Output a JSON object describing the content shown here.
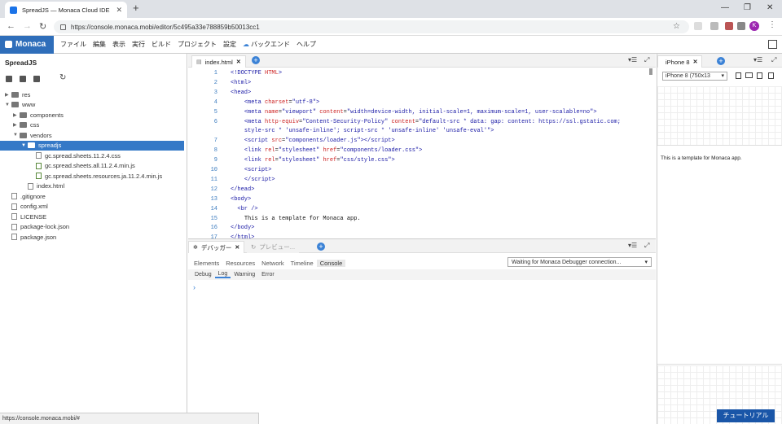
{
  "browser": {
    "tab_title": "SpreadJS — Monaca Cloud IDE",
    "url": "https://console.monaca.mobi/editor/5c495a33e788859b50013cc1",
    "avatar_letter": "K",
    "status_url": "https://console.monaca.mobi/#"
  },
  "menu": {
    "logo": "Monaca",
    "items": [
      "ファイル",
      "編集",
      "表示",
      "実行",
      "ビルド",
      "プロジェクト",
      "設定",
      "バックエンド",
      "ヘルプ"
    ]
  },
  "sidebar": {
    "project": "SpreadJS",
    "tree": [
      {
        "label": "res",
        "kind": "folder",
        "depth": 0,
        "arrow": "▶"
      },
      {
        "label": "www",
        "kind": "folder",
        "depth": 0,
        "arrow": "▼"
      },
      {
        "label": "components",
        "kind": "folder",
        "depth": 1,
        "arrow": "▶"
      },
      {
        "label": "css",
        "kind": "folder",
        "depth": 1,
        "arrow": "▶"
      },
      {
        "label": "vendors",
        "kind": "folder",
        "depth": 1,
        "arrow": "▼"
      },
      {
        "label": "spreadjs",
        "kind": "folder",
        "depth": 2,
        "arrow": "▼",
        "selected": true
      },
      {
        "label": "gc.spread.sheets.11.2.4.css",
        "kind": "file",
        "depth": 3
      },
      {
        "label": "gc.spread.sheets.all.11.2.4.min.js",
        "kind": "js",
        "depth": 3
      },
      {
        "label": "gc.spread.sheets.resources.ja.11.2.4.min.js",
        "kind": "js",
        "depth": 3
      },
      {
        "label": "index.html",
        "kind": "file",
        "depth": 2
      },
      {
        "label": ".gitignore",
        "kind": "file",
        "depth": 0
      },
      {
        "label": "config.xml",
        "kind": "file",
        "depth": 0
      },
      {
        "label": "LICENSE",
        "kind": "file",
        "depth": 0
      },
      {
        "label": "package-lock.json",
        "kind": "file",
        "depth": 0
      },
      {
        "label": "package.json",
        "kind": "file",
        "depth": 0
      }
    ]
  },
  "editor": {
    "tab": "index.html",
    "lines": [
      {
        "n": "1",
        "html": "<span class=\"tg\">&lt;!DOCTYPE</span> <span class=\"at\">HTML</span><span class=\"tg\">&gt;</span>"
      },
      {
        "n": "2",
        "html": "<span class=\"tg\">&lt;html&gt;</span>"
      },
      {
        "n": "3",
        "html": "<span class=\"tg\">&lt;head&gt;</span>"
      },
      {
        "n": "4",
        "html": "    <span class=\"tg\">&lt;meta</span> <span class=\"at\">charset</span>=<span class=\"st\">\"utf-8\"</span><span class=\"tg\">&gt;</span>"
      },
      {
        "n": "5",
        "html": "    <span class=\"tg\">&lt;meta</span> <span class=\"at\">name</span>=<span class=\"st\">\"viewport\"</span> <span class=\"at\">content</span>=<span class=\"st\">\"width=device-width, initial-scale=1, maximum-scale=1, user-scalable=no\"</span><span class=\"tg\">&gt;</span>"
      },
      {
        "n": "6",
        "html": "    <span class=\"tg\">&lt;meta</span> <span class=\"at\">http-equiv</span>=<span class=\"st\">\"Content-Security-Policy\"</span> <span class=\"at\">content</span>=<span class=\"st\">\"default-src * data: gap: content: https://ssl.gstatic.com;</span>"
      },
      {
        "n": "",
        "html": "    <span class=\"st\">style-src * 'unsafe-inline'; script-src * 'unsafe-inline' 'unsafe-eval'\"</span><span class=\"tg\">&gt;</span>"
      },
      {
        "n": "7",
        "html": "    <span class=\"tg\">&lt;script</span> <span class=\"at\">src</span>=<span class=\"st\">\"components/loader.js\"</span><span class=\"tg\">&gt;&lt;/script&gt;</span>"
      },
      {
        "n": "8",
        "html": "    <span class=\"tg\">&lt;link</span> <span class=\"at\">rel</span>=<span class=\"st\">\"stylesheet\"</span> <span class=\"at\">href</span>=<span class=\"st\">\"components/loader.css\"</span><span class=\"tg\">&gt;</span>"
      },
      {
        "n": "9",
        "html": "    <span class=\"tg\">&lt;link</span> <span class=\"at\">rel</span>=<span class=\"st\">\"stylesheet\"</span> <span class=\"at\">href</span>=<span class=\"st\">\"css/style.css\"</span><span class=\"tg\">&gt;</span>"
      },
      {
        "n": "10",
        "html": "    <span class=\"tg\">&lt;script&gt;</span>"
      },
      {
        "n": "11",
        "html": "    <span class=\"tg\">&lt;/script&gt;</span>"
      },
      {
        "n": "12",
        "html": "<span class=\"tg\">&lt;/head&gt;</span>"
      },
      {
        "n": "13",
        "html": "<span class=\"tg\">&lt;body&gt;</span>"
      },
      {
        "n": "14",
        "html": "  <span class=\"tg\">&lt;br /&gt;</span>"
      },
      {
        "n": "15",
        "html": "    <span class=\"tx\">This is a template for Monaca app.</span>"
      },
      {
        "n": "16",
        "html": "<span class=\"tg\">&lt;/body&gt;</span>"
      },
      {
        "n": "17",
        "html": "<span class=\"tg\">&lt;/html&gt;</span>"
      }
    ]
  },
  "debugger": {
    "tab": "デバッガー",
    "preview_tab": "プレビュー...",
    "nav": [
      "Elements",
      "Resources",
      "Network",
      "Timeline",
      "Console"
    ],
    "active_nav": "Console",
    "status": "Waiting for Monaca Debugger connection...",
    "sub": [
      "Debug",
      "Log",
      "Warning",
      "Error"
    ],
    "active_sub": "Log",
    "prompt": "›"
  },
  "preview": {
    "tab": "iPhone 8",
    "device": "iPhone 8 (750x13",
    "text": "This is a template for Monaca app."
  },
  "tutorial_button": "チュートリアル",
  "colors": {
    "accent": "#2f6eba",
    "selection": "#3579c7",
    "tutorial": "#1a56a8"
  }
}
